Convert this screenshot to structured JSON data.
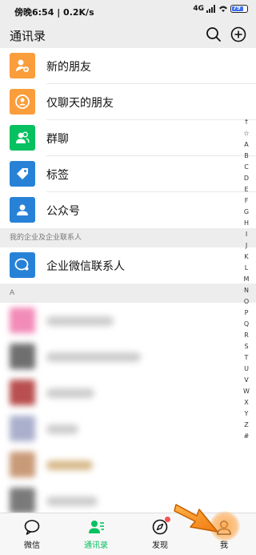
{
  "status": {
    "time": "傍晚6:54 | 0.2K/s",
    "net": "4G",
    "battery": "79"
  },
  "header": {
    "title": "通讯录"
  },
  "fixed_items": [
    {
      "label": "新的朋友",
      "icon": "new-friend-icon",
      "color": "#fa9d3b"
    },
    {
      "label": "仅聊天的朋友",
      "icon": "chat-only-friends-icon",
      "color": "#fa9d3b"
    },
    {
      "label": "群聊",
      "icon": "group-chat-icon",
      "color": "#07c160"
    },
    {
      "label": "标签",
      "icon": "tag-icon",
      "color": "#2782d7"
    },
    {
      "label": "公众号",
      "icon": "official-account-icon",
      "color": "#2782d7"
    }
  ],
  "enterprise_section": {
    "title": "我的企业及企业联系人"
  },
  "enterprise_item": {
    "label": "企业微信联系人",
    "icon": "wecom-contacts-icon",
    "color": "#2782d7"
  },
  "section_a": {
    "title": "A"
  },
  "index_letters": [
    "↑",
    "☆",
    "A",
    "B",
    "C",
    "D",
    "E",
    "F",
    "G",
    "H",
    "I",
    "J",
    "K",
    "L",
    "M",
    "N",
    "O",
    "P",
    "Q",
    "R",
    "S",
    "T",
    "U",
    "V",
    "W",
    "X",
    "Y",
    "Z",
    "#"
  ],
  "tabs": [
    {
      "label": "微信",
      "icon": "chat-bubble-icon",
      "active": false
    },
    {
      "label": "通讯录",
      "icon": "contacts-icon",
      "active": true
    },
    {
      "label": "发现",
      "icon": "compass-icon",
      "active": false
    },
    {
      "label": "我",
      "icon": "person-icon",
      "active": false
    }
  ],
  "colors": {
    "accent": "#07c160",
    "orange": "#fa9d3b",
    "blue": "#2782d7",
    "highlight": "#f7a04a"
  }
}
